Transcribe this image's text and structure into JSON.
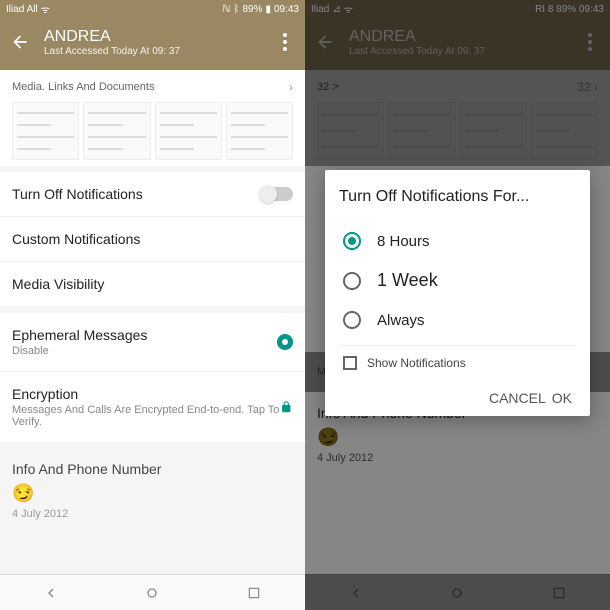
{
  "status": {
    "left_carrier": "Iliad All",
    "right_carrier": "Iliad",
    "battery_left": "89%",
    "time_left": "09:43",
    "battery_right": "RI 8 89% 09:43"
  },
  "header": {
    "contact_name": "ANDREA",
    "last_access": "Last Accessed Today At 09: 37"
  },
  "media": {
    "label": "Media. Links And Documents",
    "count_label": "32 >",
    "count_label_short": "32"
  },
  "settings": {
    "mute_label": "Turn Off Notifications",
    "custom_label": "Custom Notifications",
    "visibility_label": "Media Visibility",
    "ephemeral_label": "Ephemeral Messages",
    "ephemeral_value": "Disable",
    "encryption_label": "Encryption",
    "encryption_desc": "Messages And Calls Are Encrypted End-to-end. Tap To Verify.",
    "encryption_desc_short": "Messages Calls Are Encrypted"
  },
  "info": {
    "title": "Info And Phone Number",
    "status_emoji": "😏",
    "date": "4 July 2012"
  },
  "dialog": {
    "title": "Turn Off Notifications For...",
    "options": [
      "8 Hours",
      "1 Week",
      "Always"
    ],
    "checkbox_label": "Show Notifications",
    "cancel": "CANCEL",
    "ok": "OK"
  }
}
